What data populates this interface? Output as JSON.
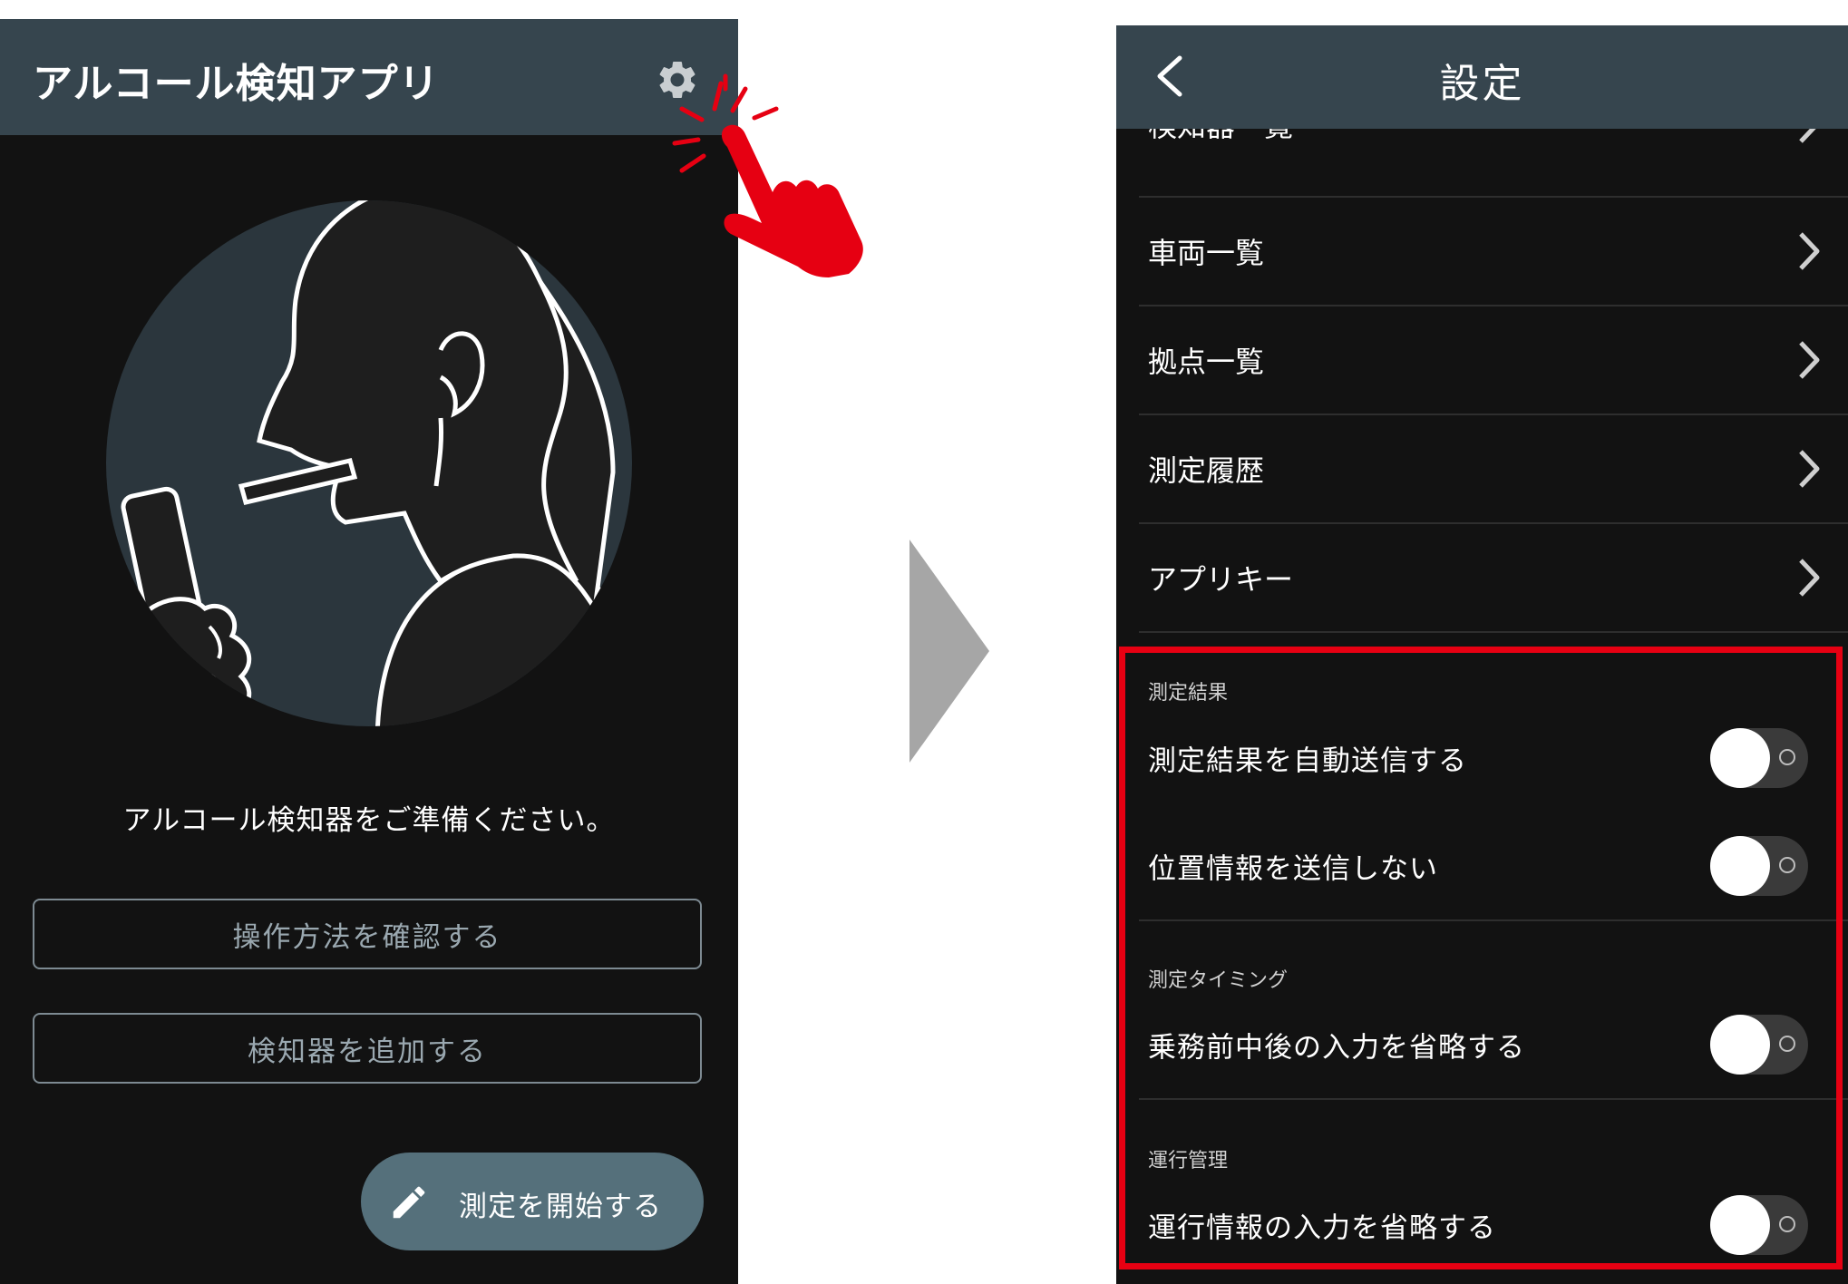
{
  "left": {
    "header_title": "アルコール検知アプリ",
    "prompt": "アルコール検知器をご準備ください。",
    "buttons": {
      "howto": "操作方法を確認する",
      "add_detector": "検知器を追加する",
      "start": "測定を開始する"
    },
    "icons": [
      "gear-icon",
      "pencil-icon",
      "pointer-hand-icon"
    ]
  },
  "right": {
    "header_title": "設定",
    "menu_items": [
      {
        "label": "検知器一覧"
      },
      {
        "label": "車両一覧"
      },
      {
        "label": "拠点一覧"
      },
      {
        "label": "測定履歴"
      },
      {
        "label": "アプリキー"
      }
    ],
    "sections": [
      {
        "title": "測定結果",
        "toggles": [
          {
            "label": "測定結果を自動送信する",
            "on": false
          },
          {
            "label": "位置情報を送信しない",
            "on": false
          }
        ]
      },
      {
        "title": "測定タイミング",
        "toggles": [
          {
            "label": "乗務前中後の入力を省略する",
            "on": false
          }
        ]
      },
      {
        "title": "運行管理",
        "toggles": [
          {
            "label": "運行情報の入力を省略する",
            "on": false
          }
        ]
      }
    ]
  },
  "colors": {
    "header": "#36454e",
    "screen_bg": "#121212",
    "accent_red": "#e60012",
    "fab": "#55707b"
  }
}
